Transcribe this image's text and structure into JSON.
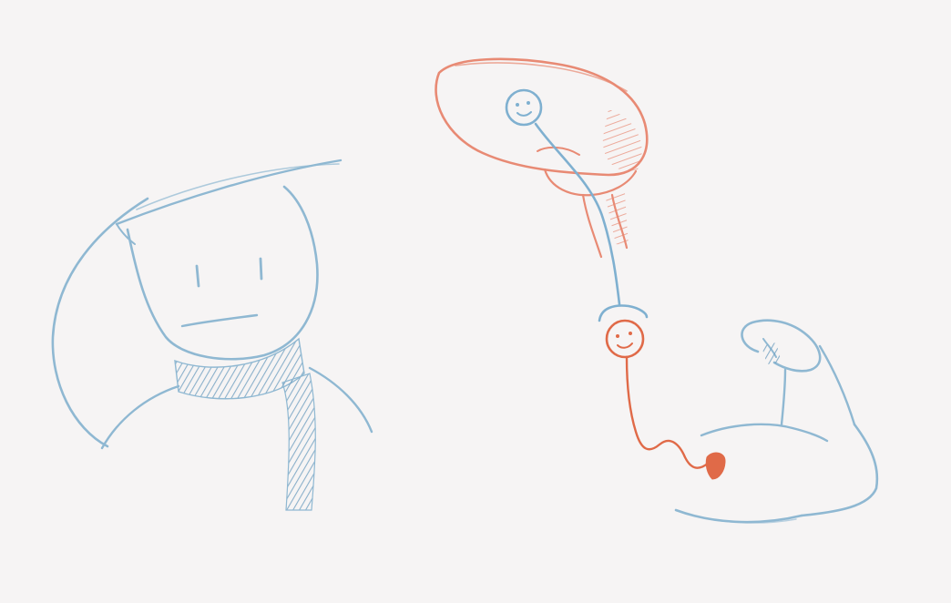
{
  "colors": {
    "background": "#f6f4f4",
    "pencil_blue": "#8fb8d2",
    "pencil_blue_dark": "#6f9fbf",
    "pencil_red": "#e88a74",
    "ink_red": "#e06a48"
  },
  "figures": [
    {
      "name": "sketch-person-with-scarf",
      "color": "pencil_blue"
    },
    {
      "name": "sketch-brain",
      "color": "pencil_red"
    },
    {
      "name": "sketch-upper-motor-neuron",
      "color": "pencil_blue"
    },
    {
      "name": "sketch-lower-motor-neuron",
      "color": "ink_red"
    },
    {
      "name": "sketch-flexed-arm",
      "color": "pencil_blue"
    }
  ]
}
